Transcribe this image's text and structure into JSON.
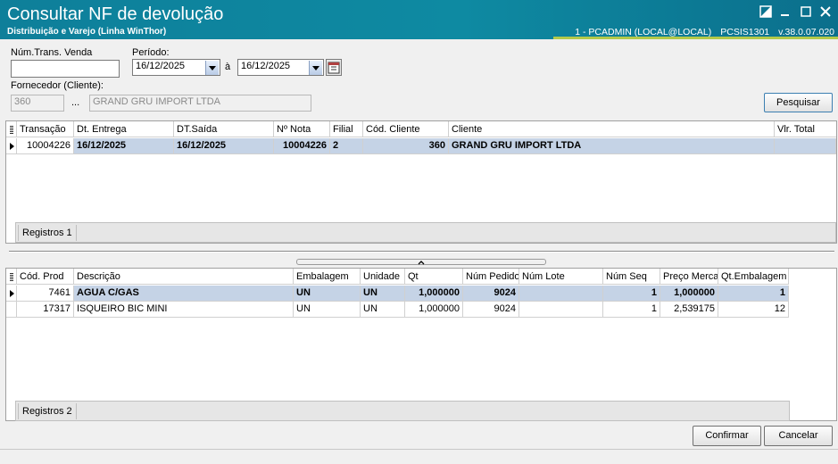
{
  "window": {
    "title": "Consultar NF de devolução",
    "subtitle": "Distribuição e Varejo (Linha WinThor)",
    "user": "1 - PCADMIN (LOCAL@LOCAL)",
    "routine": "PCSIS1301",
    "version": "v.38.0.07.020"
  },
  "filters": {
    "trans_label": "Núm.Trans. Venda",
    "trans_value": "",
    "periodo_label": "Período:",
    "date_start": "16/12/2025",
    "date_sep": "à",
    "date_end": "16/12/2025",
    "fornecedor_label": "Fornecedor (Cliente):",
    "fornecedor_code": "360",
    "ellipsis": "...",
    "fornecedor_name": "GRAND GRU IMPORT LTDA",
    "search_button": "Pesquisar"
  },
  "grid1": {
    "columns": [
      "Transação",
      "Dt. Entrega",
      "DT.Saída",
      "Nº Nota",
      "Filial",
      "Cód. Cliente",
      "Cliente",
      "Vlr. Total"
    ],
    "rows": [
      [
        "10004226",
        "16/12/2025",
        "16/12/2025",
        "10004226",
        "2",
        "360",
        "GRAND GRU IMPORT LTDA",
        ""
      ]
    ],
    "footer": "Registros 1"
  },
  "grid2": {
    "columns": [
      "Cód. Prod",
      "Descrição",
      "Embalagem",
      "Unidade",
      "Qt",
      "Núm Pedido",
      "Núm Lote",
      "Núm Seq",
      "Preço Merca",
      "Qt.Embalagem"
    ],
    "rows": [
      [
        "7461",
        "AGUA C/GAS",
        "UN",
        "UN",
        "1,000000",
        "9024",
        "",
        "1",
        "1,000000",
        "1"
      ],
      [
        "17317",
        "ISQUEIRO BIC MINI",
        "UN",
        "UN",
        "1,000000",
        "9024",
        "",
        "1",
        "2,539175",
        "12"
      ]
    ],
    "footer": "Registros 2"
  },
  "actions": {
    "confirm": "Confirmar",
    "cancel": "Cancelar"
  },
  "colors": {
    "titlebar": "#0e8aa2",
    "accent": "#b3c94a",
    "selected_row": "#c5d3e6"
  }
}
